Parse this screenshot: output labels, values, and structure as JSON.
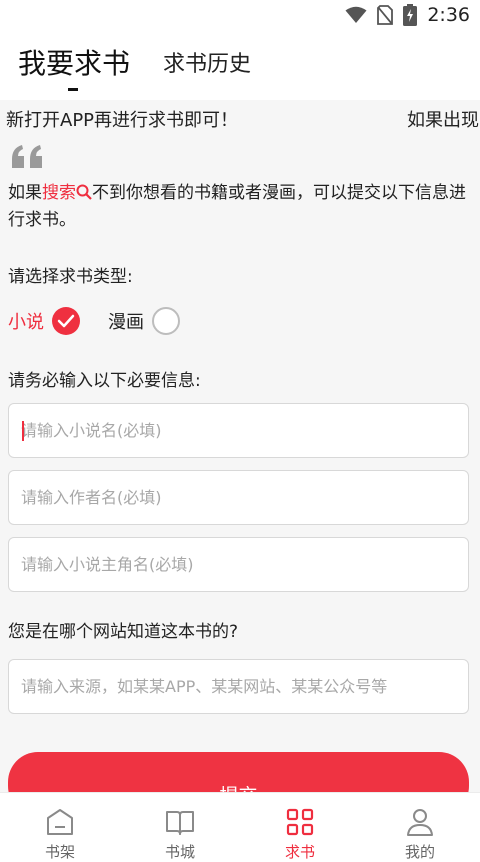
{
  "status_bar": {
    "time": "2:36",
    "icons": [
      "wifi-icon",
      "no-sim-icon",
      "battery-charging-icon"
    ]
  },
  "header": {
    "tabs": [
      {
        "label": "我要求书",
        "active": true
      },
      {
        "label": "求书历史",
        "active": false
      }
    ]
  },
  "notice": {
    "marquee_part1": "新打开APP再进行求书即可！",
    "marquee_part2": "如果出现"
  },
  "intro": {
    "before": "如果",
    "highlight": "搜索",
    "after": "不到你想看的书籍或者漫画，可以提交以下信息进行求书。"
  },
  "type_section": {
    "label": "请选择求书类型:",
    "options": [
      {
        "label": "小说",
        "selected": true
      },
      {
        "label": "漫画",
        "selected": false
      }
    ]
  },
  "required_section": {
    "label": "请务必输入以下必要信息:",
    "fields": [
      {
        "placeholder": "请输入小说名(必填)",
        "value": ""
      },
      {
        "placeholder": "请输入作者名(必填)",
        "value": ""
      },
      {
        "placeholder": "请输入小说主角名(必填)",
        "value": ""
      }
    ]
  },
  "source_section": {
    "label": "您是在哪个网站知道这本书的?",
    "placeholder": "请输入来源，如某某APP、某某网站、某某公众号等",
    "value": ""
  },
  "submit_label": "提交",
  "bottom_nav": [
    {
      "label": "书架",
      "icon": "bookshelf-icon",
      "active": false
    },
    {
      "label": "书城",
      "icon": "book-open-icon",
      "active": false
    },
    {
      "label": "求书",
      "icon": "grid-icon",
      "active": true
    },
    {
      "label": "我的",
      "icon": "user-icon",
      "active": false
    }
  ],
  "colors": {
    "accent": "#ef2e3f",
    "content_bg": "#f6f6f6",
    "text": "#222222",
    "placeholder": "#a8a8a8"
  }
}
